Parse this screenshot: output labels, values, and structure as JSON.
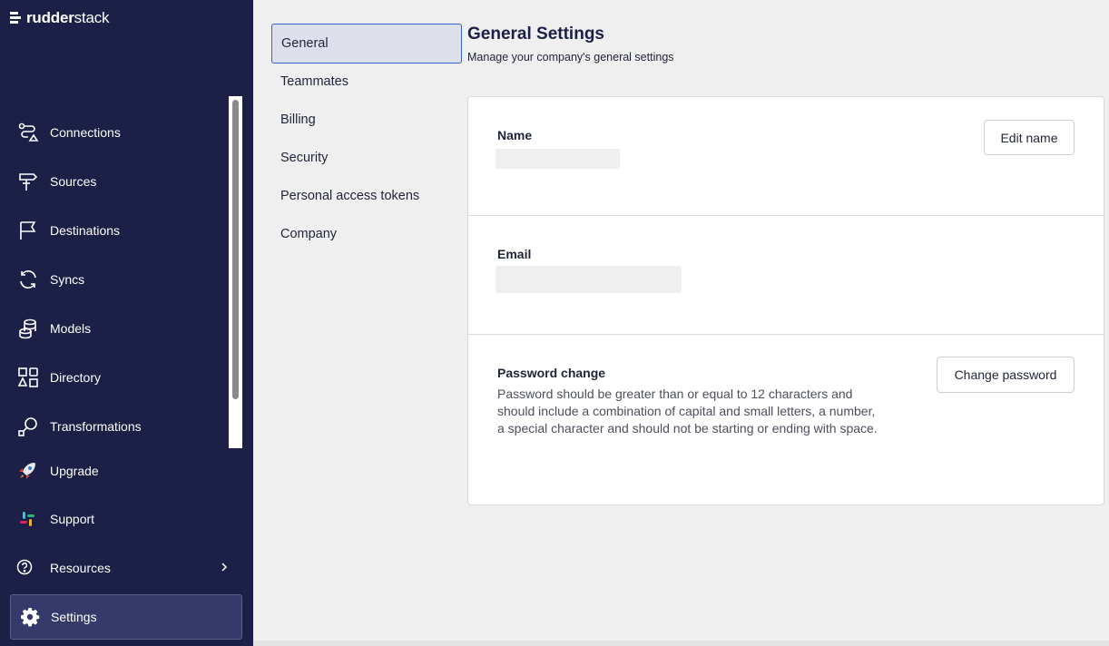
{
  "brand": {
    "bold": "rudder",
    "light": "stack"
  },
  "sidebar": {
    "items": [
      {
        "label": "Connections",
        "icon": "connections-icon"
      },
      {
        "label": "Sources",
        "icon": "signpost-icon"
      },
      {
        "label": "Destinations",
        "icon": "flag-icon"
      },
      {
        "label": "Syncs",
        "icon": "sync-icon"
      },
      {
        "label": "Models",
        "icon": "database-icon"
      },
      {
        "label": "Directory",
        "icon": "shapes-icon"
      },
      {
        "label": "Transformations",
        "icon": "transform-icon"
      }
    ],
    "bottom": {
      "upgrade": "Upgrade",
      "support": "Support",
      "resources": "Resources",
      "settings": "Settings"
    }
  },
  "settings_nav": {
    "items": [
      "General",
      "Teammates",
      "Billing",
      "Security",
      "Personal access tokens",
      "Company"
    ],
    "active": "General"
  },
  "header": {
    "title": "General Settings",
    "subtitle": "Manage your company's general settings"
  },
  "card": {
    "name_label": "Name",
    "edit_name_button": "Edit name",
    "email_label": "Email",
    "password_label": "Password change",
    "password_description": "Password should be greater than or equal to 12 characters and should include a combination of capital and small letters, a number, a special character and should not be starting or ending with space.",
    "change_password_button": "Change password"
  },
  "colors": {
    "sidebar_bg": "#1c1f46",
    "active_border": "#3a62c9",
    "page_bg": "#efefef"
  }
}
